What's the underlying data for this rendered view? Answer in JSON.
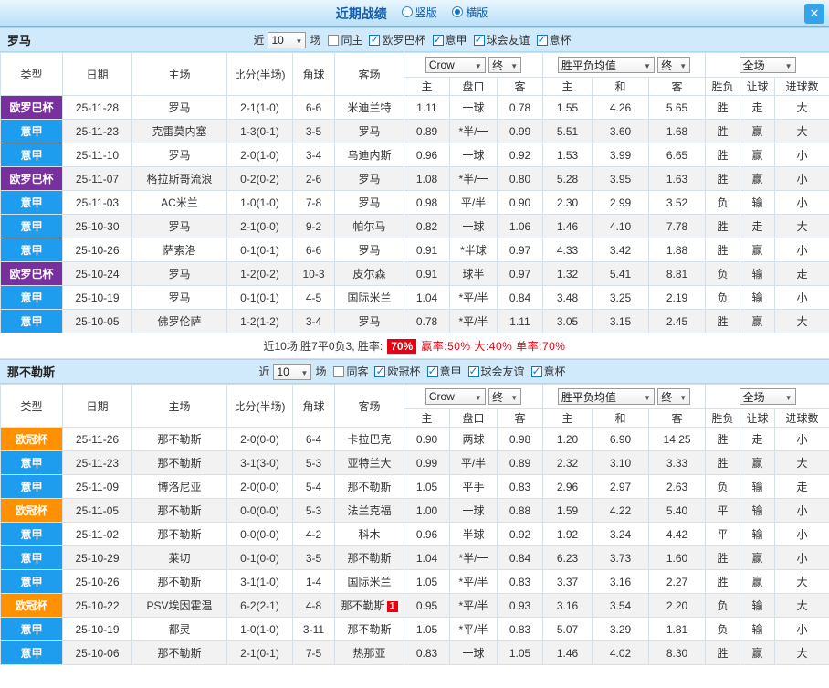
{
  "window": {
    "title": "近期战绩",
    "layout_options": [
      {
        "label": "竖版",
        "selected": false
      },
      {
        "label": "横版",
        "selected": true
      }
    ],
    "close_label": "✕"
  },
  "filter_static": {
    "near": "近",
    "count": "10",
    "games": "场"
  },
  "table_head": {
    "type": "类型",
    "date": "日期",
    "home": "主场",
    "score": "比分(半场)",
    "corners": "角球",
    "away": "客场",
    "sub": {
      "home_odds": "主",
      "handicap": "盘口",
      "away_odds": "客",
      "europe_home": "主",
      "europe_draw": "和",
      "europe_away": "客",
      "result": "胜负",
      "handicap_result": "让球",
      "goals": "进球数"
    },
    "selects": {
      "bookmaker": "Crow",
      "final1": "终",
      "avg": "胜平负均值",
      "final2": "终",
      "scope": "全场"
    }
  },
  "colors": {
    "red": "#e60012",
    "green": "#009933",
    "blue": "#0b6bc8",
    "team_green": "#008800",
    "odds_blue": "#0b6bc8"
  },
  "league_colors": {
    "欧罗巴杯": "#7a2f9e",
    "意甲": "#1e9dee",
    "欧冠杯": "#ff9000"
  },
  "sections": [
    {
      "team": "罗马",
      "filters": [
        {
          "label": "同主",
          "checked": false
        },
        {
          "label": "欧罗巴杯",
          "checked": true
        },
        {
          "label": "意甲",
          "checked": true
        },
        {
          "label": "球会友谊",
          "checked": true
        },
        {
          "label": "意杯",
          "checked": true
        }
      ],
      "rows": [
        {
          "league": "欧罗巴杯",
          "date": "25-11-28",
          "home": "罗马",
          "home_focus": true,
          "score": "2-1(1-0)",
          "score_draw": false,
          "corners": "6-6",
          "away": "米迪兰特",
          "away_focus": false,
          "away_badge": "",
          "odds": [
            "1.11",
            "一球",
            "0.78"
          ],
          "line_red": false,
          "europe": [
            "1.55",
            "4.26",
            "5.65"
          ],
          "result": "胜",
          "result_color": "red",
          "handicap_result": "走",
          "handicap_result_color": "blue",
          "goals": "大",
          "goals_color": "red"
        },
        {
          "league": "意甲",
          "date": "25-11-23",
          "home": "克雷莫内塞",
          "home_focus": false,
          "score": "1-3(0-1)",
          "score_draw": false,
          "corners": "3-5",
          "away": "罗马",
          "away_focus": true,
          "away_badge": "",
          "odds": [
            "0.89",
            "*半/一",
            "0.99"
          ],
          "line_red": true,
          "europe": [
            "5.51",
            "3.60",
            "1.68"
          ],
          "result": "胜",
          "result_color": "red",
          "handicap_result": "赢",
          "handicap_result_color": "red",
          "goals": "大",
          "goals_color": "red"
        },
        {
          "league": "意甲",
          "date": "25-11-10",
          "home": "罗马",
          "home_focus": true,
          "score": "2-0(1-0)",
          "score_draw": false,
          "corners": "3-4",
          "away": "乌迪内斯",
          "away_focus": false,
          "away_badge": "",
          "odds": [
            "0.96",
            "一球",
            "0.92"
          ],
          "line_red": false,
          "europe": [
            "1.53",
            "3.99",
            "6.65"
          ],
          "result": "胜",
          "result_color": "red",
          "handicap_result": "赢",
          "handicap_result_color": "red",
          "goals": "小",
          "goals_color": "green"
        },
        {
          "league": "欧罗巴杯",
          "date": "25-11-07",
          "home": "格拉斯哥流浪",
          "home_focus": false,
          "score": "0-2(0-2)",
          "score_draw": false,
          "corners": "2-6",
          "away": "罗马",
          "away_focus": true,
          "away_badge": "",
          "odds": [
            "1.08",
            "*半/一",
            "0.80"
          ],
          "line_red": true,
          "europe": [
            "5.28",
            "3.95",
            "1.63"
          ],
          "result": "胜",
          "result_color": "red",
          "handicap_result": "赢",
          "handicap_result_color": "red",
          "goals": "小",
          "goals_color": "green"
        },
        {
          "league": "意甲",
          "date": "25-11-03",
          "home": "AC米兰",
          "home_focus": false,
          "score": "1-0(1-0)",
          "score_draw": false,
          "corners": "7-8",
          "away": "罗马",
          "away_focus": true,
          "away_badge": "",
          "odds": [
            "0.98",
            "平/半",
            "0.90"
          ],
          "line_red": false,
          "europe": [
            "2.30",
            "2.99",
            "3.52"
          ],
          "result": "负",
          "result_color": "blue",
          "handicap_result": "输",
          "handicap_result_color": "green",
          "goals": "小",
          "goals_color": "green"
        },
        {
          "league": "意甲",
          "date": "25-10-30",
          "home": "罗马",
          "home_focus": true,
          "score": "2-1(0-0)",
          "score_draw": false,
          "corners": "9-2",
          "away": "帕尔马",
          "away_focus": false,
          "away_badge": "",
          "odds": [
            "0.82",
            "一球",
            "1.06"
          ],
          "line_red": false,
          "europe": [
            "1.46",
            "4.10",
            "7.78"
          ],
          "result": "胜",
          "result_color": "red",
          "handicap_result": "走",
          "handicap_result_color": "blue",
          "goals": "大",
          "goals_color": "red"
        },
        {
          "league": "意甲",
          "date": "25-10-26",
          "home": "萨索洛",
          "home_focus": false,
          "score": "0-1(0-1)",
          "score_draw": false,
          "corners": "6-6",
          "away": "罗马",
          "away_focus": true,
          "away_badge": "",
          "odds": [
            "0.91",
            "*半球",
            "0.97"
          ],
          "line_red": true,
          "europe": [
            "4.33",
            "3.42",
            "1.88"
          ],
          "result": "胜",
          "result_color": "red",
          "handicap_result": "赢",
          "handicap_result_color": "red",
          "goals": "小",
          "goals_color": "green"
        },
        {
          "league": "欧罗巴杯",
          "date": "25-10-24",
          "home": "罗马",
          "home_focus": true,
          "score": "1-2(0-2)",
          "score_draw": false,
          "corners": "10-3",
          "away": "皮尔森",
          "away_focus": false,
          "away_badge": "",
          "odds": [
            "0.91",
            "球半",
            "0.97"
          ],
          "line_red": false,
          "europe": [
            "1.32",
            "5.41",
            "8.81"
          ],
          "result": "负",
          "result_color": "blue",
          "handicap_result": "输",
          "handicap_result_color": "green",
          "goals": "走",
          "goals_color": "blue"
        },
        {
          "league": "意甲",
          "date": "25-10-19",
          "home": "罗马",
          "home_focus": true,
          "score": "0-1(0-1)",
          "score_draw": false,
          "corners": "4-5",
          "away": "国际米兰",
          "away_focus": false,
          "away_badge": "",
          "odds": [
            "1.04",
            "*平/半",
            "0.84"
          ],
          "line_red": true,
          "europe": [
            "3.48",
            "3.25",
            "2.19"
          ],
          "result": "负",
          "result_color": "blue",
          "handicap_result": "输",
          "handicap_result_color": "green",
          "goals": "小",
          "goals_color": "green"
        },
        {
          "league": "意甲",
          "date": "25-10-05",
          "home": "佛罗伦萨",
          "home_focus": false,
          "score": "1-2(1-2)",
          "score_draw": false,
          "corners": "3-4",
          "away": "罗马",
          "away_focus": true,
          "away_badge": "",
          "odds": [
            "0.78",
            "*平/半",
            "1.11"
          ],
          "line_red": true,
          "europe": [
            "3.05",
            "3.15",
            "2.45"
          ],
          "result": "胜",
          "result_color": "red",
          "handicap_result": "赢",
          "handicap_result_color": "red",
          "goals": "大",
          "goals_color": "red"
        }
      ],
      "summary": {
        "text": "近10场,胜7平0负3, 胜率:",
        "rate": "70%",
        "tail": "赢率:50% 大:40% 单率:70%"
      }
    },
    {
      "team": "那不勒斯",
      "filters": [
        {
          "label": "同客",
          "checked": false
        },
        {
          "label": "欧冠杯",
          "checked": true
        },
        {
          "label": "意甲",
          "checked": true
        },
        {
          "label": "球会友谊",
          "checked": true
        },
        {
          "label": "意杯",
          "checked": true
        }
      ],
      "rows": [
        {
          "league": "欧冠杯",
          "date": "25-11-26",
          "home": "那不勒斯",
          "home_focus": true,
          "score": "2-0(0-0)",
          "score_draw": false,
          "corners": "6-4",
          "away": "卡拉巴克",
          "away_focus": false,
          "away_badge": "",
          "odds": [
            "0.90",
            "两球",
            "0.98"
          ],
          "line_red": false,
          "europe": [
            "1.20",
            "6.90",
            "14.25"
          ],
          "result": "胜",
          "result_color": "red",
          "handicap_result": "走",
          "handicap_result_color": "blue",
          "goals": "小",
          "goals_color": "green"
        },
        {
          "league": "意甲",
          "date": "25-11-23",
          "home": "那不勒斯",
          "home_focus": true,
          "score": "3-1(3-0)",
          "score_draw": false,
          "corners": "5-3",
          "away": "亚特兰大",
          "away_focus": false,
          "away_badge": "",
          "odds": [
            "0.99",
            "平/半",
            "0.89"
          ],
          "line_red": false,
          "europe": [
            "2.32",
            "3.10",
            "3.33"
          ],
          "result": "胜",
          "result_color": "red",
          "handicap_result": "赢",
          "handicap_result_color": "red",
          "goals": "大",
          "goals_color": "red"
        },
        {
          "league": "意甲",
          "date": "25-11-09",
          "home": "博洛尼亚",
          "home_focus": false,
          "score": "2-0(0-0)",
          "score_draw": false,
          "corners": "5-4",
          "away": "那不勒斯",
          "away_focus": true,
          "away_badge": "",
          "odds": [
            "1.05",
            "平手",
            "0.83"
          ],
          "line_red": false,
          "europe": [
            "2.96",
            "2.97",
            "2.63"
          ],
          "result": "负",
          "result_color": "blue",
          "handicap_result": "输",
          "handicap_result_color": "green",
          "goals": "走",
          "goals_color": "blue"
        },
        {
          "league": "欧冠杯",
          "date": "25-11-05",
          "home": "那不勒斯",
          "home_focus": true,
          "score": "0-0(0-0)",
          "score_draw": true,
          "corners": "5-3",
          "away": "法兰克福",
          "away_focus": false,
          "away_badge": "",
          "odds": [
            "1.00",
            "一球",
            "0.88"
          ],
          "line_red": false,
          "europe": [
            "1.59",
            "4.22",
            "5.40"
          ],
          "result": "平",
          "result_color": "blue",
          "handicap_result": "输",
          "handicap_result_color": "green",
          "goals": "小",
          "goals_color": "green"
        },
        {
          "league": "意甲",
          "date": "25-11-02",
          "home": "那不勒斯",
          "home_focus": true,
          "score": "0-0(0-0)",
          "score_draw": true,
          "corners": "4-2",
          "away": "科木",
          "away_focus": false,
          "away_badge": "",
          "odds": [
            "0.96",
            "半球",
            "0.92"
          ],
          "line_red": false,
          "europe": [
            "1.92",
            "3.24",
            "4.42"
          ],
          "result": "平",
          "result_color": "blue",
          "handicap_result": "输",
          "handicap_result_color": "green",
          "goals": "小",
          "goals_color": "green"
        },
        {
          "league": "意甲",
          "date": "25-10-29",
          "home": "莱切",
          "home_focus": false,
          "score": "0-1(0-0)",
          "score_draw": false,
          "corners": "3-5",
          "away": "那不勒斯",
          "away_focus": true,
          "away_badge": "",
          "odds": [
            "1.04",
            "*半/一",
            "0.84"
          ],
          "line_red": true,
          "europe": [
            "6.23",
            "3.73",
            "1.60"
          ],
          "result": "胜",
          "result_color": "red",
          "handicap_result": "赢",
          "handicap_result_color": "red",
          "goals": "小",
          "goals_color": "green"
        },
        {
          "league": "意甲",
          "date": "25-10-26",
          "home": "那不勒斯",
          "home_focus": true,
          "score": "3-1(1-0)",
          "score_draw": false,
          "corners": "1-4",
          "away": "国际米兰",
          "away_focus": false,
          "away_badge": "",
          "odds": [
            "1.05",
            "*平/半",
            "0.83"
          ],
          "line_red": true,
          "europe": [
            "3.37",
            "3.16",
            "2.27"
          ],
          "result": "胜",
          "result_color": "red",
          "handicap_result": "赢",
          "handicap_result_color": "red",
          "goals": "大",
          "goals_color": "red"
        },
        {
          "league": "欧冠杯",
          "date": "25-10-22",
          "home": "PSV埃因霍温",
          "home_focus": false,
          "score": "6-2(2-1)",
          "score_draw": false,
          "corners": "4-8",
          "away": "那不勒斯",
          "away_focus": true,
          "away_badge": "1",
          "odds": [
            "0.95",
            "*平/半",
            "0.93"
          ],
          "line_red": true,
          "europe": [
            "3.16",
            "3.54",
            "2.20"
          ],
          "result": "负",
          "result_color": "blue",
          "handicap_result": "输",
          "handicap_result_color": "green",
          "goals": "大",
          "goals_color": "red"
        },
        {
          "league": "意甲",
          "date": "25-10-19",
          "home": "都灵",
          "home_focus": false,
          "score": "1-0(1-0)",
          "score_draw": false,
          "corners": "3-11",
          "away": "那不勒斯",
          "away_focus": true,
          "away_badge": "",
          "odds": [
            "1.05",
            "*平/半",
            "0.83"
          ],
          "line_red": true,
          "europe": [
            "5.07",
            "3.29",
            "1.81"
          ],
          "result": "负",
          "result_color": "blue",
          "handicap_result": "输",
          "handicap_result_color": "green",
          "goals": "小",
          "goals_color": "green"
        },
        {
          "league": "意甲",
          "date": "25-10-06",
          "home": "那不勒斯",
          "home_focus": true,
          "score": "2-1(0-1)",
          "score_draw": false,
          "corners": "7-5",
          "away": "热那亚",
          "away_focus": false,
          "away_badge": "",
          "odds": [
            "0.83",
            "一球",
            "1.05"
          ],
          "line_red": false,
          "europe": [
            "1.46",
            "4.02",
            "8.30"
          ],
          "result": "胜",
          "result_color": "red",
          "handicap_result": "赢",
          "handicap_result_color": "red",
          "goals": "大",
          "goals_color": "red"
        }
      ],
      "summary": null
    }
  ]
}
